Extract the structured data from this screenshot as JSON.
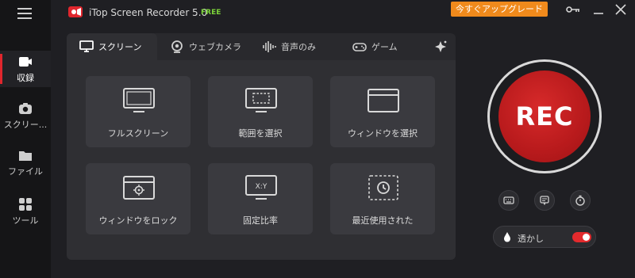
{
  "app": {
    "title": "iTop Screen Recorder 5.0",
    "badge": "FREE"
  },
  "header": {
    "upgrade_label": "今すぐアップグレード"
  },
  "sidebar": {
    "items": [
      {
        "label": "収録",
        "icon": "record-icon",
        "active": true
      },
      {
        "label": "スクリー...",
        "icon": "camera-icon",
        "active": false
      },
      {
        "label": "ファイル",
        "icon": "folder-icon",
        "active": false
      },
      {
        "label": "ツール",
        "icon": "tools-icon",
        "active": false
      }
    ]
  },
  "tabs": [
    {
      "label": "スクリーン",
      "icon": "monitor-icon",
      "active": true
    },
    {
      "label": "ウェブカメラ",
      "icon": "webcam-icon",
      "active": false
    },
    {
      "label": "音声のみ",
      "icon": "audio-wave-icon",
      "active": false
    },
    {
      "label": "ゲーム",
      "icon": "gamepad-icon",
      "active": false
    },
    {
      "label": "",
      "icon": "sparkle-icon",
      "active": false
    }
  ],
  "modes": [
    {
      "label": "フルスクリーン",
      "icon": "fullscreen-icon"
    },
    {
      "label": "範囲を選択",
      "icon": "region-select-icon"
    },
    {
      "label": "ウィンドウを選択",
      "icon": "window-select-icon"
    },
    {
      "label": "ウィンドウをロック",
      "icon": "window-lock-icon"
    },
    {
      "label": "固定比率",
      "icon": "fixed-ratio-icon",
      "icon_text": "X:Y"
    },
    {
      "label": "最近使用された",
      "icon": "recent-icon"
    }
  ],
  "rec": {
    "label": "REC"
  },
  "quick_tools": [
    {
      "icon": "keyboard-icon"
    },
    {
      "icon": "note-icon"
    },
    {
      "icon": "timer-icon"
    }
  ],
  "watermark": {
    "label": "透かし",
    "enabled": true
  },
  "colors": {
    "accent": "#e0262d",
    "upgrade": "#f08a1c",
    "free": "#7bd23a"
  }
}
